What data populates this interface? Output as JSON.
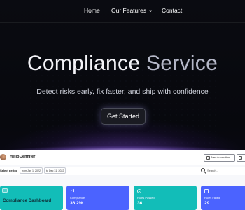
{
  "nav": {
    "home": "Home",
    "features": "Our Features",
    "contact": "Contact"
  },
  "hero": {
    "title_main": "Compliance",
    "title_accent": "Service",
    "subtitle": "Detect risks early, fix faster, and ship with confidence",
    "cta": "Get Started"
  },
  "dashboard": {
    "greeting": "Hello Jennifer",
    "new_automation": "New Automation",
    "select_period": "Select period",
    "date_from": "from Jan 1, 2022",
    "date_to": "to Dec 31, 2022",
    "search_placeholder": "Search...",
    "cards": [
      {
        "title": "Compliance Dashboard"
      },
      {
        "label": "Compliance",
        "value": "36.2%"
      },
      {
        "label": "Rules Passed",
        "value": "36"
      },
      {
        "label": "Rules Failed",
        "value": "29"
      }
    ]
  },
  "colors": {
    "background": "#07080d",
    "teal_card": "#12bdb8",
    "blue_card": "#4b63ff",
    "cta_glow": "#aaa0ff"
  },
  "icons": [
    "chevron-down-icon",
    "search-icon",
    "plus-icon",
    "chart-icon",
    "target-icon",
    "calculator-icon"
  ]
}
